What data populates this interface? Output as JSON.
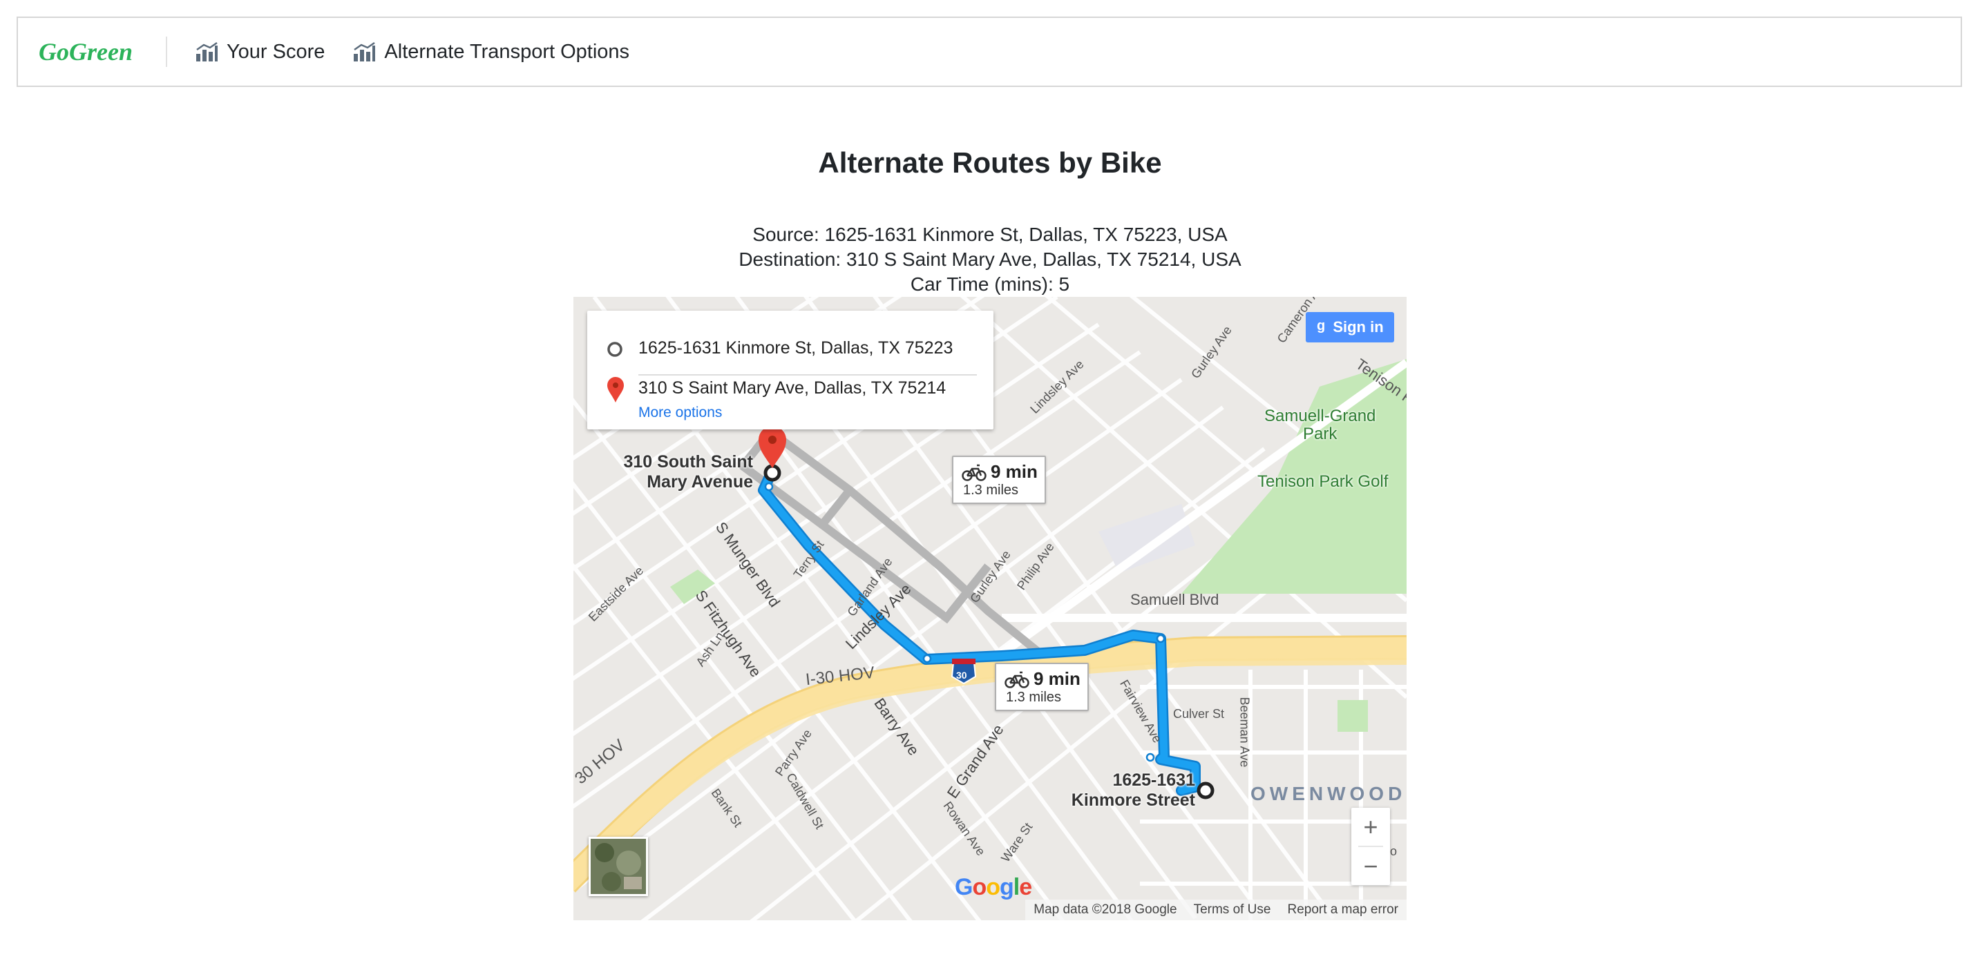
{
  "nav": {
    "brand": "GoGreen",
    "items": [
      {
        "label": "Your Score",
        "icon": "chart-icon"
      },
      {
        "label": "Alternate Transport Options",
        "icon": "chart-icon"
      }
    ]
  },
  "page": {
    "title": "Alternate Routes by Bike",
    "source": "Source: 1625-1631 Kinmore St, Dallas, TX 75223, USA",
    "destination": "Destination: 310 S Saint Mary Ave, Dallas, TX 75214, USA",
    "car_time": "Car Time (mins): 5"
  },
  "map": {
    "directions": {
      "origin": "1625-1631 Kinmore St, Dallas, TX 75223",
      "destination": "310 S Saint Mary Ave, Dallas, TX 75214",
      "more_options": "More options"
    },
    "sign_in": "Sign in",
    "routes": [
      {
        "time": "9 min",
        "distance": "1.3 miles"
      },
      {
        "time": "9 min",
        "distance": "1.3 miles"
      }
    ],
    "places": {
      "destination_label_1": "310 South Saint",
      "destination_label_2": "Mary Avenue",
      "origin_label_1": "1625-1631",
      "origin_label_2": "Kinmore Street",
      "park_1a": "Samuell-Grand",
      "park_1b": "Park",
      "park_2": "Tenison Park Golf",
      "neighborhood": "OWENWOOD"
    },
    "streets": {
      "lindsley_1": "Lindsley Ave",
      "lindsley_2": "Lindsley Ave",
      "samuell_blvd": "Samuell Blvd",
      "i30_hov": "I-30 HOV",
      "hov_left": "30 HOV",
      "munger": "S Munger Blvd",
      "fitzhugh": "S Fitzhugh Ave",
      "barry": "Barry Ave",
      "e_grand": "E Grand Ave",
      "culver": "Culver St",
      "fairview": "Fairview Ave",
      "beeman": "Beeman Ave",
      "gurley": "Gurley Ave",
      "philip": "Philip Ave",
      "eastside": "Eastside Ave",
      "parry": "Parry Ave",
      "caldwell": "Caldwell St",
      "bank": "Bank St",
      "ash": "Ash Ln",
      "terry": "Terry St",
      "garland": "Garland Ave",
      "rowan": "Rowan Ave",
      "ware": "Ware St",
      "tenison": "Tenison P",
      "cameron": "Cameron Ave",
      "reyno": "Reyno",
      "highway_shield": "30"
    },
    "zoom_in": "+",
    "zoom_out": "−",
    "google": {
      "G": "G",
      "o1": "o",
      "o2": "o",
      "g": "g",
      "l": "l",
      "e": "e"
    },
    "footer": {
      "map_data": "Map data ©2018 Google",
      "terms": "Terms of Use",
      "report": "Report a map error"
    }
  },
  "colors": {
    "brand": "#2cb35a",
    "route": "#1ba1f2",
    "route_outline": "#1a73e8",
    "alt_route": "#b5b5b5",
    "highway": "#fbe29e",
    "park": "#c5e8b8",
    "sign_in": "#4d90fe"
  }
}
